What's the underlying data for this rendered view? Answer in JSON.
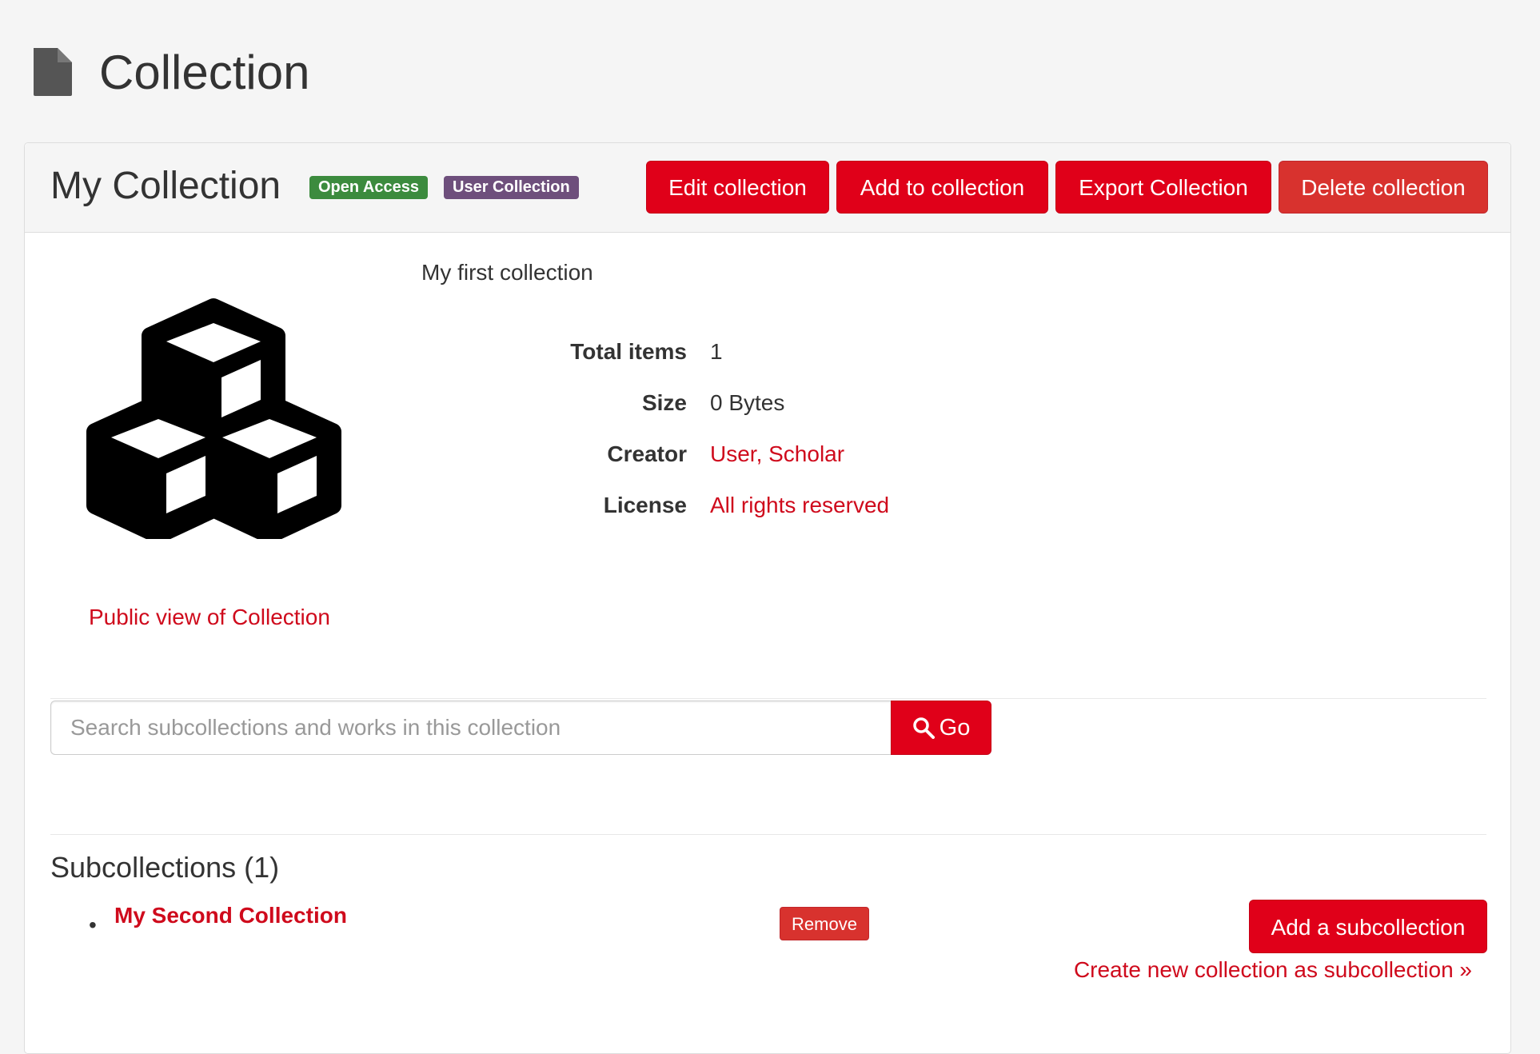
{
  "page": {
    "title": "Collection",
    "title_icon": "file-icon"
  },
  "collection": {
    "title": "My Collection",
    "badges": [
      "Open Access",
      "User Collection"
    ],
    "description": "My first collection",
    "thumbnail_icon": "cubes-icon",
    "actions": {
      "edit": "Edit collection",
      "add": "Add to collection",
      "export": "Export Collection",
      "delete": "Delete collection"
    },
    "metadata": [
      {
        "label": "Total items",
        "value": "1"
      },
      {
        "label": "Size",
        "value": "0 Bytes"
      },
      {
        "label": "Creator",
        "value": "User, Scholar"
      },
      {
        "label": "License",
        "value": "All rights reserved"
      }
    ],
    "public_view_link": "Public view of Collection"
  },
  "search": {
    "placeholder": "Search subcollections and works in this collection",
    "button_label": "Go"
  },
  "subcollections": {
    "heading": "Subcollections (1)",
    "items": [
      {
        "title": "My Second Collection",
        "remove_label": "Remove"
      }
    ],
    "add_button": "Add a subcollection",
    "create_link": "Create new collection as subcollection »"
  },
  "colors": {
    "primary_red": "#e00019",
    "danger_red": "#d8322e",
    "link_red": "#cf0a1c",
    "badge_green": "#3c8b3e",
    "badge_purple": "#6e4f7c"
  }
}
